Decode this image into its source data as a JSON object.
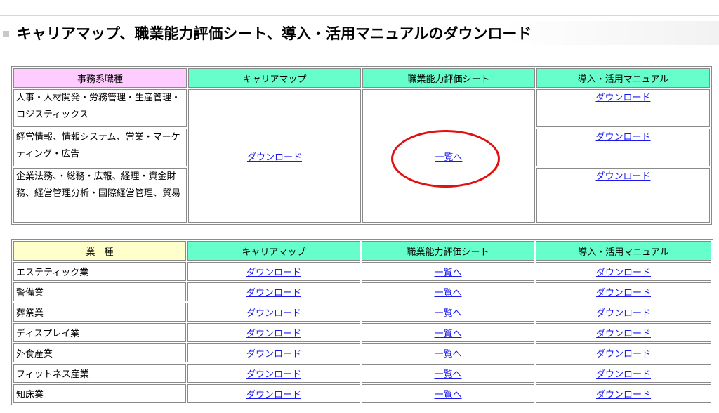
{
  "page": {
    "title": "キャリアマップ、職業能力評価シート、導入・活用マニュアルのダウンロード"
  },
  "office_table": {
    "headers": [
      "事務系職種",
      "キャリアマップ",
      "職業能力評価シート",
      "導入・活用マニュアル"
    ],
    "rows": [
      {
        "name": "人事・人材開発・労務管理・生産管理・ロジスティックス",
        "manual": "ダウンロード"
      },
      {
        "name": "経営情報、情報システム、営業・マーケティング・広告",
        "manual": "ダウンロード"
      },
      {
        "name": "企業法務、・総務・広報、経理・資金財務、経営管理分析・国際経営管理、貿易",
        "manual": "ダウンロード"
      }
    ],
    "career_map": "ダウンロード",
    "eval_sheet": "一覧へ"
  },
  "industry_table": {
    "headers": [
      "業　種",
      "キャリアマップ",
      "職業能力評価シート",
      "導入・活用マニュアル"
    ],
    "rows": [
      {
        "name": "エステティック業",
        "career_map": "ダウンロード",
        "eval_sheet": "一覧へ",
        "manual": "ダウンロード"
      },
      {
        "name": "警備業",
        "career_map": "ダウンロード",
        "eval_sheet": "一覧へ",
        "manual": "ダウンロード"
      },
      {
        "name": "葬祭業",
        "career_map": "ダウンロード",
        "eval_sheet": "一覧へ",
        "manual": "ダウンロード"
      },
      {
        "name": "ディスプレイ業",
        "career_map": "ダウンロード",
        "eval_sheet": "一覧へ",
        "manual": "ダウンロード"
      },
      {
        "name": "外食産業",
        "career_map": "ダウンロード",
        "eval_sheet": "一覧へ",
        "manual": "ダウンロード"
      },
      {
        "name": "フィットネス産業",
        "career_map": "ダウンロード",
        "eval_sheet": "一覧へ",
        "manual": "ダウンロード"
      },
      {
        "name": "知床業",
        "career_map": "ダウンロード",
        "eval_sheet": "一覧へ",
        "manual": "ダウンロード"
      }
    ]
  },
  "annotation": {
    "color": "#e31010"
  }
}
